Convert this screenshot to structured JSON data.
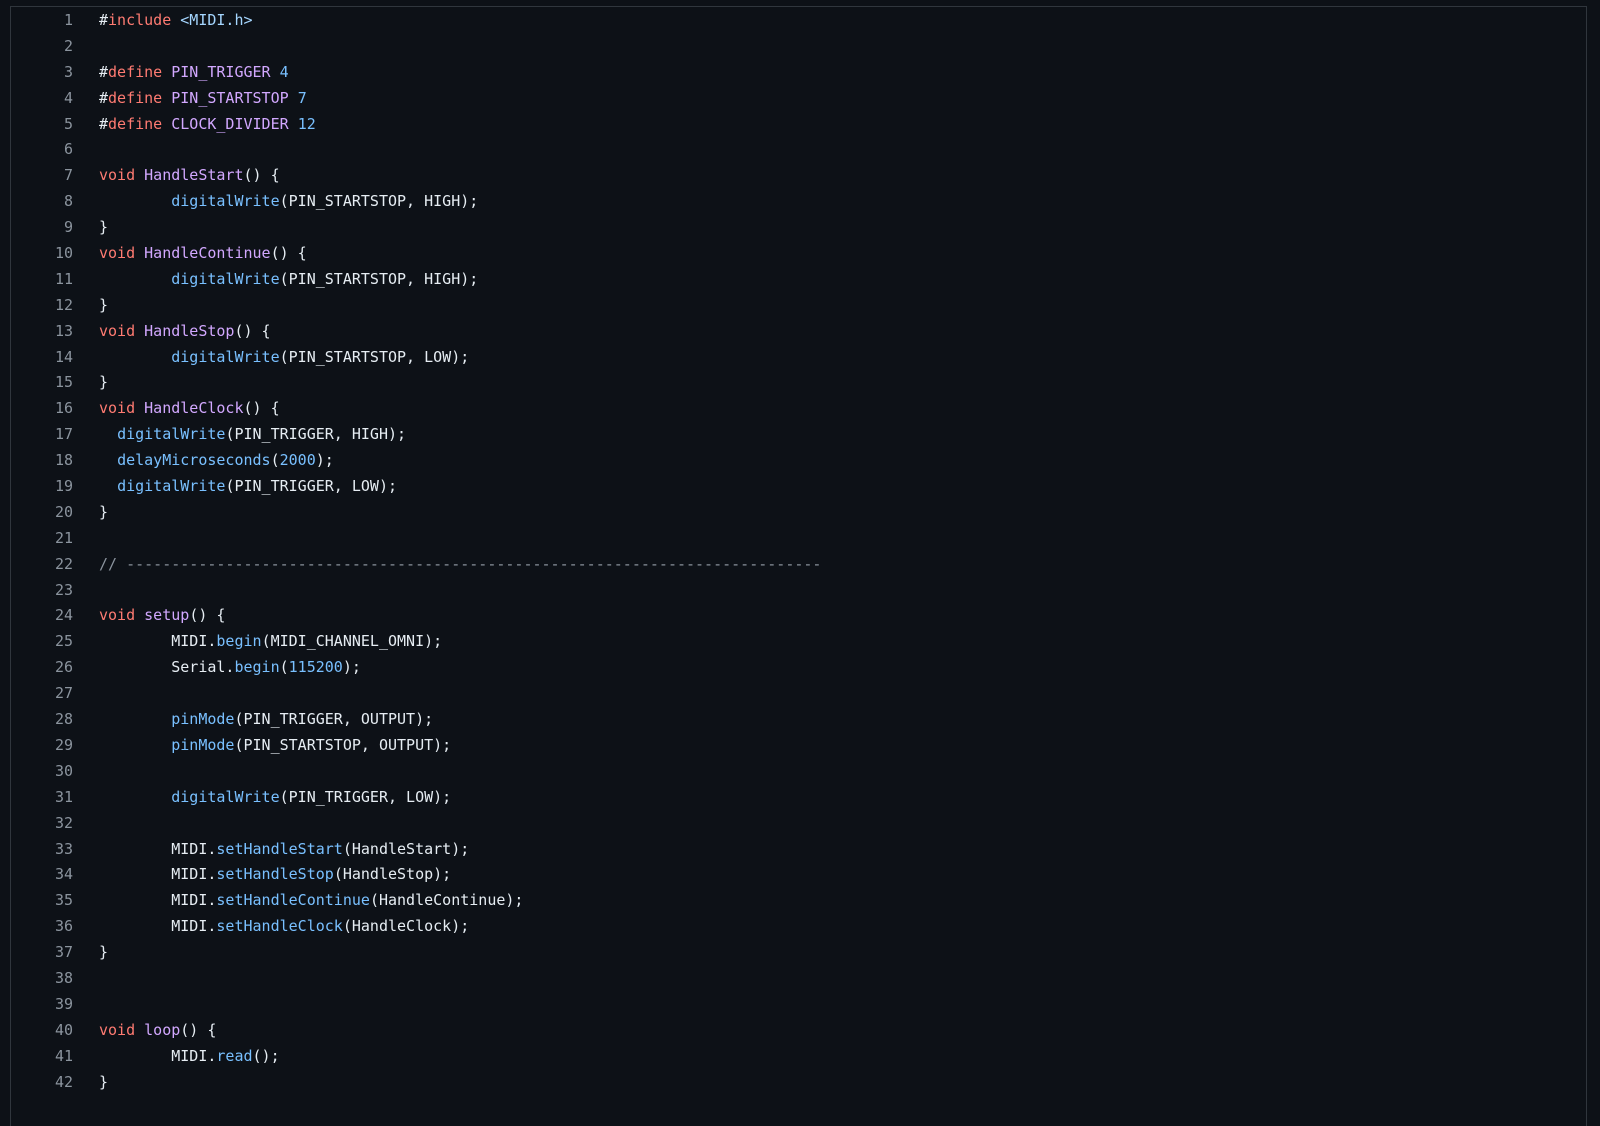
{
  "code_view": {
    "lines": [
      {
        "num": "1",
        "tokens": [
          {
            "t": "#",
            "c": "plain"
          },
          {
            "t": "include",
            "c": "keyword"
          },
          {
            "t": " ",
            "c": "plain"
          },
          {
            "t": "<MIDI.h>",
            "c": "include"
          }
        ]
      },
      {
        "num": "2",
        "tokens": []
      },
      {
        "num": "3",
        "tokens": [
          {
            "t": "#",
            "c": "plain"
          },
          {
            "t": "define",
            "c": "keyword"
          },
          {
            "t": " ",
            "c": "plain"
          },
          {
            "t": "PIN_TRIGGER",
            "c": "func"
          },
          {
            "t": " ",
            "c": "plain"
          },
          {
            "t": "4",
            "c": "number"
          }
        ]
      },
      {
        "num": "4",
        "tokens": [
          {
            "t": "#",
            "c": "plain"
          },
          {
            "t": "define",
            "c": "keyword"
          },
          {
            "t": " ",
            "c": "plain"
          },
          {
            "t": "PIN_STARTSTOP",
            "c": "func"
          },
          {
            "t": " ",
            "c": "plain"
          },
          {
            "t": "7",
            "c": "number"
          }
        ]
      },
      {
        "num": "5",
        "tokens": [
          {
            "t": "#",
            "c": "plain"
          },
          {
            "t": "define",
            "c": "keyword"
          },
          {
            "t": " ",
            "c": "plain"
          },
          {
            "t": "CLOCK_DIVIDER",
            "c": "func"
          },
          {
            "t": " ",
            "c": "plain"
          },
          {
            "t": "12",
            "c": "number"
          }
        ]
      },
      {
        "num": "6",
        "tokens": []
      },
      {
        "num": "7",
        "tokens": [
          {
            "t": "void",
            "c": "keyword"
          },
          {
            "t": " ",
            "c": "plain"
          },
          {
            "t": "HandleStart",
            "c": "func"
          },
          {
            "t": "() {",
            "c": "plain"
          }
        ]
      },
      {
        "num": "8",
        "tokens": [
          {
            "t": "        ",
            "c": "plain"
          },
          {
            "t": "digitalWrite",
            "c": "call"
          },
          {
            "t": "(PIN_STARTSTOP, HIGH);",
            "c": "plain"
          }
        ]
      },
      {
        "num": "9",
        "tokens": [
          {
            "t": "}",
            "c": "plain"
          }
        ]
      },
      {
        "num": "10",
        "tokens": [
          {
            "t": "void",
            "c": "keyword"
          },
          {
            "t": " ",
            "c": "plain"
          },
          {
            "t": "HandleContinue",
            "c": "func"
          },
          {
            "t": "() {",
            "c": "plain"
          }
        ]
      },
      {
        "num": "11",
        "tokens": [
          {
            "t": "        ",
            "c": "plain"
          },
          {
            "t": "digitalWrite",
            "c": "call"
          },
          {
            "t": "(PIN_STARTSTOP, HIGH);",
            "c": "plain"
          }
        ]
      },
      {
        "num": "12",
        "tokens": [
          {
            "t": "}",
            "c": "plain"
          }
        ]
      },
      {
        "num": "13",
        "tokens": [
          {
            "t": "void",
            "c": "keyword"
          },
          {
            "t": " ",
            "c": "plain"
          },
          {
            "t": "HandleStop",
            "c": "func"
          },
          {
            "t": "() {",
            "c": "plain"
          }
        ]
      },
      {
        "num": "14",
        "tokens": [
          {
            "t": "        ",
            "c": "plain"
          },
          {
            "t": "digitalWrite",
            "c": "call"
          },
          {
            "t": "(PIN_STARTSTOP, LOW);",
            "c": "plain"
          }
        ]
      },
      {
        "num": "15",
        "tokens": [
          {
            "t": "}",
            "c": "plain"
          }
        ]
      },
      {
        "num": "16",
        "tokens": [
          {
            "t": "void",
            "c": "keyword"
          },
          {
            "t": " ",
            "c": "plain"
          },
          {
            "t": "HandleClock",
            "c": "func"
          },
          {
            "t": "() {",
            "c": "plain"
          }
        ]
      },
      {
        "num": "17",
        "tokens": [
          {
            "t": "  ",
            "c": "plain"
          },
          {
            "t": "digitalWrite",
            "c": "call"
          },
          {
            "t": "(PIN_TRIGGER, HIGH);",
            "c": "plain"
          }
        ]
      },
      {
        "num": "18",
        "tokens": [
          {
            "t": "  ",
            "c": "plain"
          },
          {
            "t": "delayMicroseconds",
            "c": "call"
          },
          {
            "t": "(",
            "c": "plain"
          },
          {
            "t": "2000",
            "c": "number"
          },
          {
            "t": ");",
            "c": "plain"
          }
        ]
      },
      {
        "num": "19",
        "tokens": [
          {
            "t": "  ",
            "c": "plain"
          },
          {
            "t": "digitalWrite",
            "c": "call"
          },
          {
            "t": "(PIN_TRIGGER, LOW);",
            "c": "plain"
          }
        ]
      },
      {
        "num": "20",
        "tokens": [
          {
            "t": "}",
            "c": "plain"
          }
        ]
      },
      {
        "num": "21",
        "tokens": []
      },
      {
        "num": "22",
        "tokens": [
          {
            "t": "// -----------------------------------------------------------------------------",
            "c": "comment"
          }
        ]
      },
      {
        "num": "23",
        "tokens": []
      },
      {
        "num": "24",
        "tokens": [
          {
            "t": "void",
            "c": "keyword"
          },
          {
            "t": " ",
            "c": "plain"
          },
          {
            "t": "setup",
            "c": "func"
          },
          {
            "t": "() {",
            "c": "plain"
          }
        ]
      },
      {
        "num": "25",
        "tokens": [
          {
            "t": "        MIDI.",
            "c": "plain"
          },
          {
            "t": "begin",
            "c": "call"
          },
          {
            "t": "(MIDI_CHANNEL_OMNI);",
            "c": "plain"
          }
        ]
      },
      {
        "num": "26",
        "tokens": [
          {
            "t": "        Serial.",
            "c": "plain"
          },
          {
            "t": "begin",
            "c": "call"
          },
          {
            "t": "(",
            "c": "plain"
          },
          {
            "t": "115200",
            "c": "number"
          },
          {
            "t": ");",
            "c": "plain"
          }
        ]
      },
      {
        "num": "27",
        "tokens": []
      },
      {
        "num": "28",
        "tokens": [
          {
            "t": "        ",
            "c": "plain"
          },
          {
            "t": "pinMode",
            "c": "call"
          },
          {
            "t": "(PIN_TRIGGER, OUTPUT);",
            "c": "plain"
          }
        ]
      },
      {
        "num": "29",
        "tokens": [
          {
            "t": "        ",
            "c": "plain"
          },
          {
            "t": "pinMode",
            "c": "call"
          },
          {
            "t": "(PIN_STARTSTOP, OUTPUT);",
            "c": "plain"
          }
        ]
      },
      {
        "num": "30",
        "tokens": []
      },
      {
        "num": "31",
        "tokens": [
          {
            "t": "        ",
            "c": "plain"
          },
          {
            "t": "digitalWrite",
            "c": "call"
          },
          {
            "t": "(PIN_TRIGGER, LOW);",
            "c": "plain"
          }
        ]
      },
      {
        "num": "32",
        "tokens": []
      },
      {
        "num": "33",
        "tokens": [
          {
            "t": "        MIDI.",
            "c": "plain"
          },
          {
            "t": "setHandleStart",
            "c": "call"
          },
          {
            "t": "(HandleStart);",
            "c": "plain"
          }
        ]
      },
      {
        "num": "34",
        "tokens": [
          {
            "t": "        MIDI.",
            "c": "plain"
          },
          {
            "t": "setHandleStop",
            "c": "call"
          },
          {
            "t": "(HandleStop);",
            "c": "plain"
          }
        ]
      },
      {
        "num": "35",
        "tokens": [
          {
            "t": "        MIDI.",
            "c": "plain"
          },
          {
            "t": "setHandleContinue",
            "c": "call"
          },
          {
            "t": "(HandleContinue);",
            "c": "plain"
          }
        ]
      },
      {
        "num": "36",
        "tokens": [
          {
            "t": "        MIDI.",
            "c": "plain"
          },
          {
            "t": "setHandleClock",
            "c": "call"
          },
          {
            "t": "(HandleClock);",
            "c": "plain"
          }
        ]
      },
      {
        "num": "37",
        "tokens": [
          {
            "t": "}",
            "c": "plain"
          }
        ]
      },
      {
        "num": "38",
        "tokens": []
      },
      {
        "num": "39",
        "tokens": []
      },
      {
        "num": "40",
        "tokens": [
          {
            "t": "void",
            "c": "keyword"
          },
          {
            "t": " ",
            "c": "plain"
          },
          {
            "t": "loop",
            "c": "func"
          },
          {
            "t": "() {",
            "c": "plain"
          }
        ]
      },
      {
        "num": "41",
        "tokens": [
          {
            "t": "        MIDI.",
            "c": "plain"
          },
          {
            "t": "read",
            "c": "call"
          },
          {
            "t": "();",
            "c": "plain"
          }
        ]
      },
      {
        "num": "42",
        "tokens": [
          {
            "t": "}",
            "c": "plain"
          }
        ]
      }
    ]
  },
  "colors": {
    "background": "#0d1117",
    "line_number": "#8b949e",
    "keyword": "#ff7b72",
    "function_name": "#d2a8ff",
    "call": "#79c0ff",
    "number": "#79c0ff",
    "text": "#e6edf3"
  }
}
